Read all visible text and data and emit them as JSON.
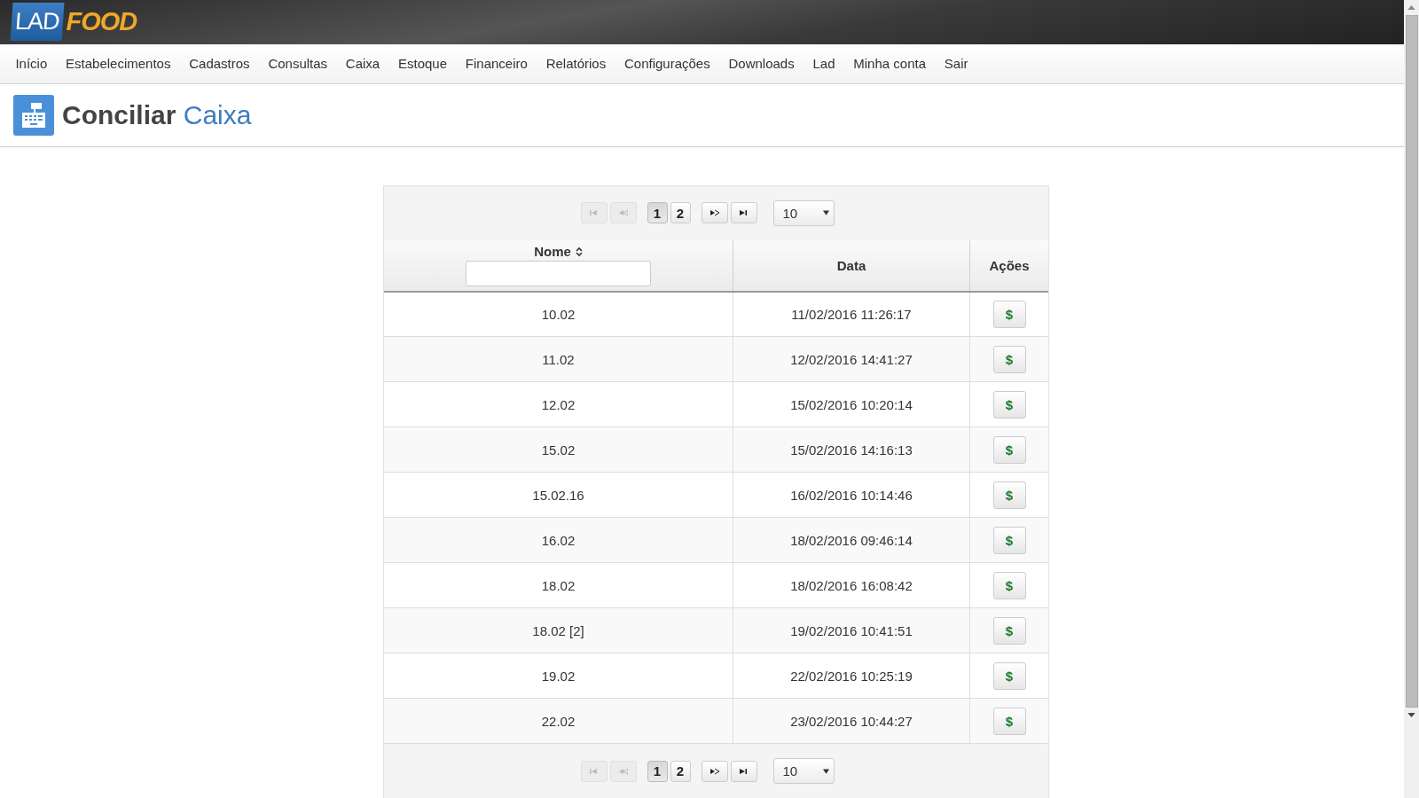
{
  "header": {
    "logo": {
      "part_1": "LAD",
      "part_2": "FOOD"
    }
  },
  "menu": [
    {
      "label": "Início"
    },
    {
      "label": "Estabelecimentos"
    },
    {
      "label": "Cadastros"
    },
    {
      "label": "Consultas"
    },
    {
      "label": "Caixa"
    },
    {
      "label": "Estoque"
    },
    {
      "label": "Financeiro"
    },
    {
      "label": "Relatórios"
    },
    {
      "label": "Configurações"
    },
    {
      "label": "Downloads"
    },
    {
      "label": "Lad"
    },
    {
      "label": "Minha conta"
    },
    {
      "label": "Sair"
    }
  ],
  "page_title": {
    "main": "Conciliar",
    "accent": "Caixa"
  },
  "paginator_top": {
    "nav": [
      {
        "kind": "first",
        "disabled": true
      },
      {
        "kind": "prev",
        "disabled": true
      },
      {
        "kind": "next",
        "disabled": false
      },
      {
        "kind": "last",
        "disabled": false
      }
    ],
    "pages": [
      {
        "label": "1",
        "selected": true
      },
      {
        "label": "2",
        "selected": false
      }
    ],
    "page_size": "10"
  },
  "table": {
    "columns": [
      {
        "label": "Nome",
        "sortable": true,
        "filter": true
      },
      {
        "label": "Data",
        "sortable": false,
        "filter": false
      },
      {
        "label": "Ações",
        "sortable": false,
        "filter": false
      }
    ],
    "rows": [
      {
        "nome": "10.02",
        "data": "11/02/2016 11:26:17",
        "action": "$"
      },
      {
        "nome": "11.02",
        "data": "12/02/2016 14:41:27",
        "action": "$"
      },
      {
        "nome": "12.02",
        "data": "15/02/2016 10:20:14",
        "action": "$"
      },
      {
        "nome": "15.02",
        "data": "15/02/2016 14:16:13",
        "action": "$"
      },
      {
        "nome": "15.02.16",
        "data": "16/02/2016 10:14:46",
        "action": "$"
      },
      {
        "nome": "16.02",
        "data": "18/02/2016 09:46:14",
        "action": "$"
      },
      {
        "nome": "18.02",
        "data": "18/02/2016 16:08:42",
        "action": "$"
      },
      {
        "nome": "18.02 [2]",
        "data": "19/02/2016 10:41:51",
        "action": "$"
      },
      {
        "nome": "19.02",
        "data": "22/02/2016 10:25:19",
        "action": "$"
      },
      {
        "nome": "22.02",
        "data": "23/02/2016 10:44:27",
        "action": "$"
      }
    ]
  },
  "paginator_bottom": {
    "nav": [
      {
        "kind": "first",
        "disabled": true
      },
      {
        "kind": "prev",
        "disabled": true
      },
      {
        "kind": "next",
        "disabled": false
      },
      {
        "kind": "last",
        "disabled": false
      }
    ],
    "pages": [
      {
        "label": "1",
        "selected": true
      },
      {
        "label": "2",
        "selected": false
      }
    ],
    "page_size": "10"
  }
}
